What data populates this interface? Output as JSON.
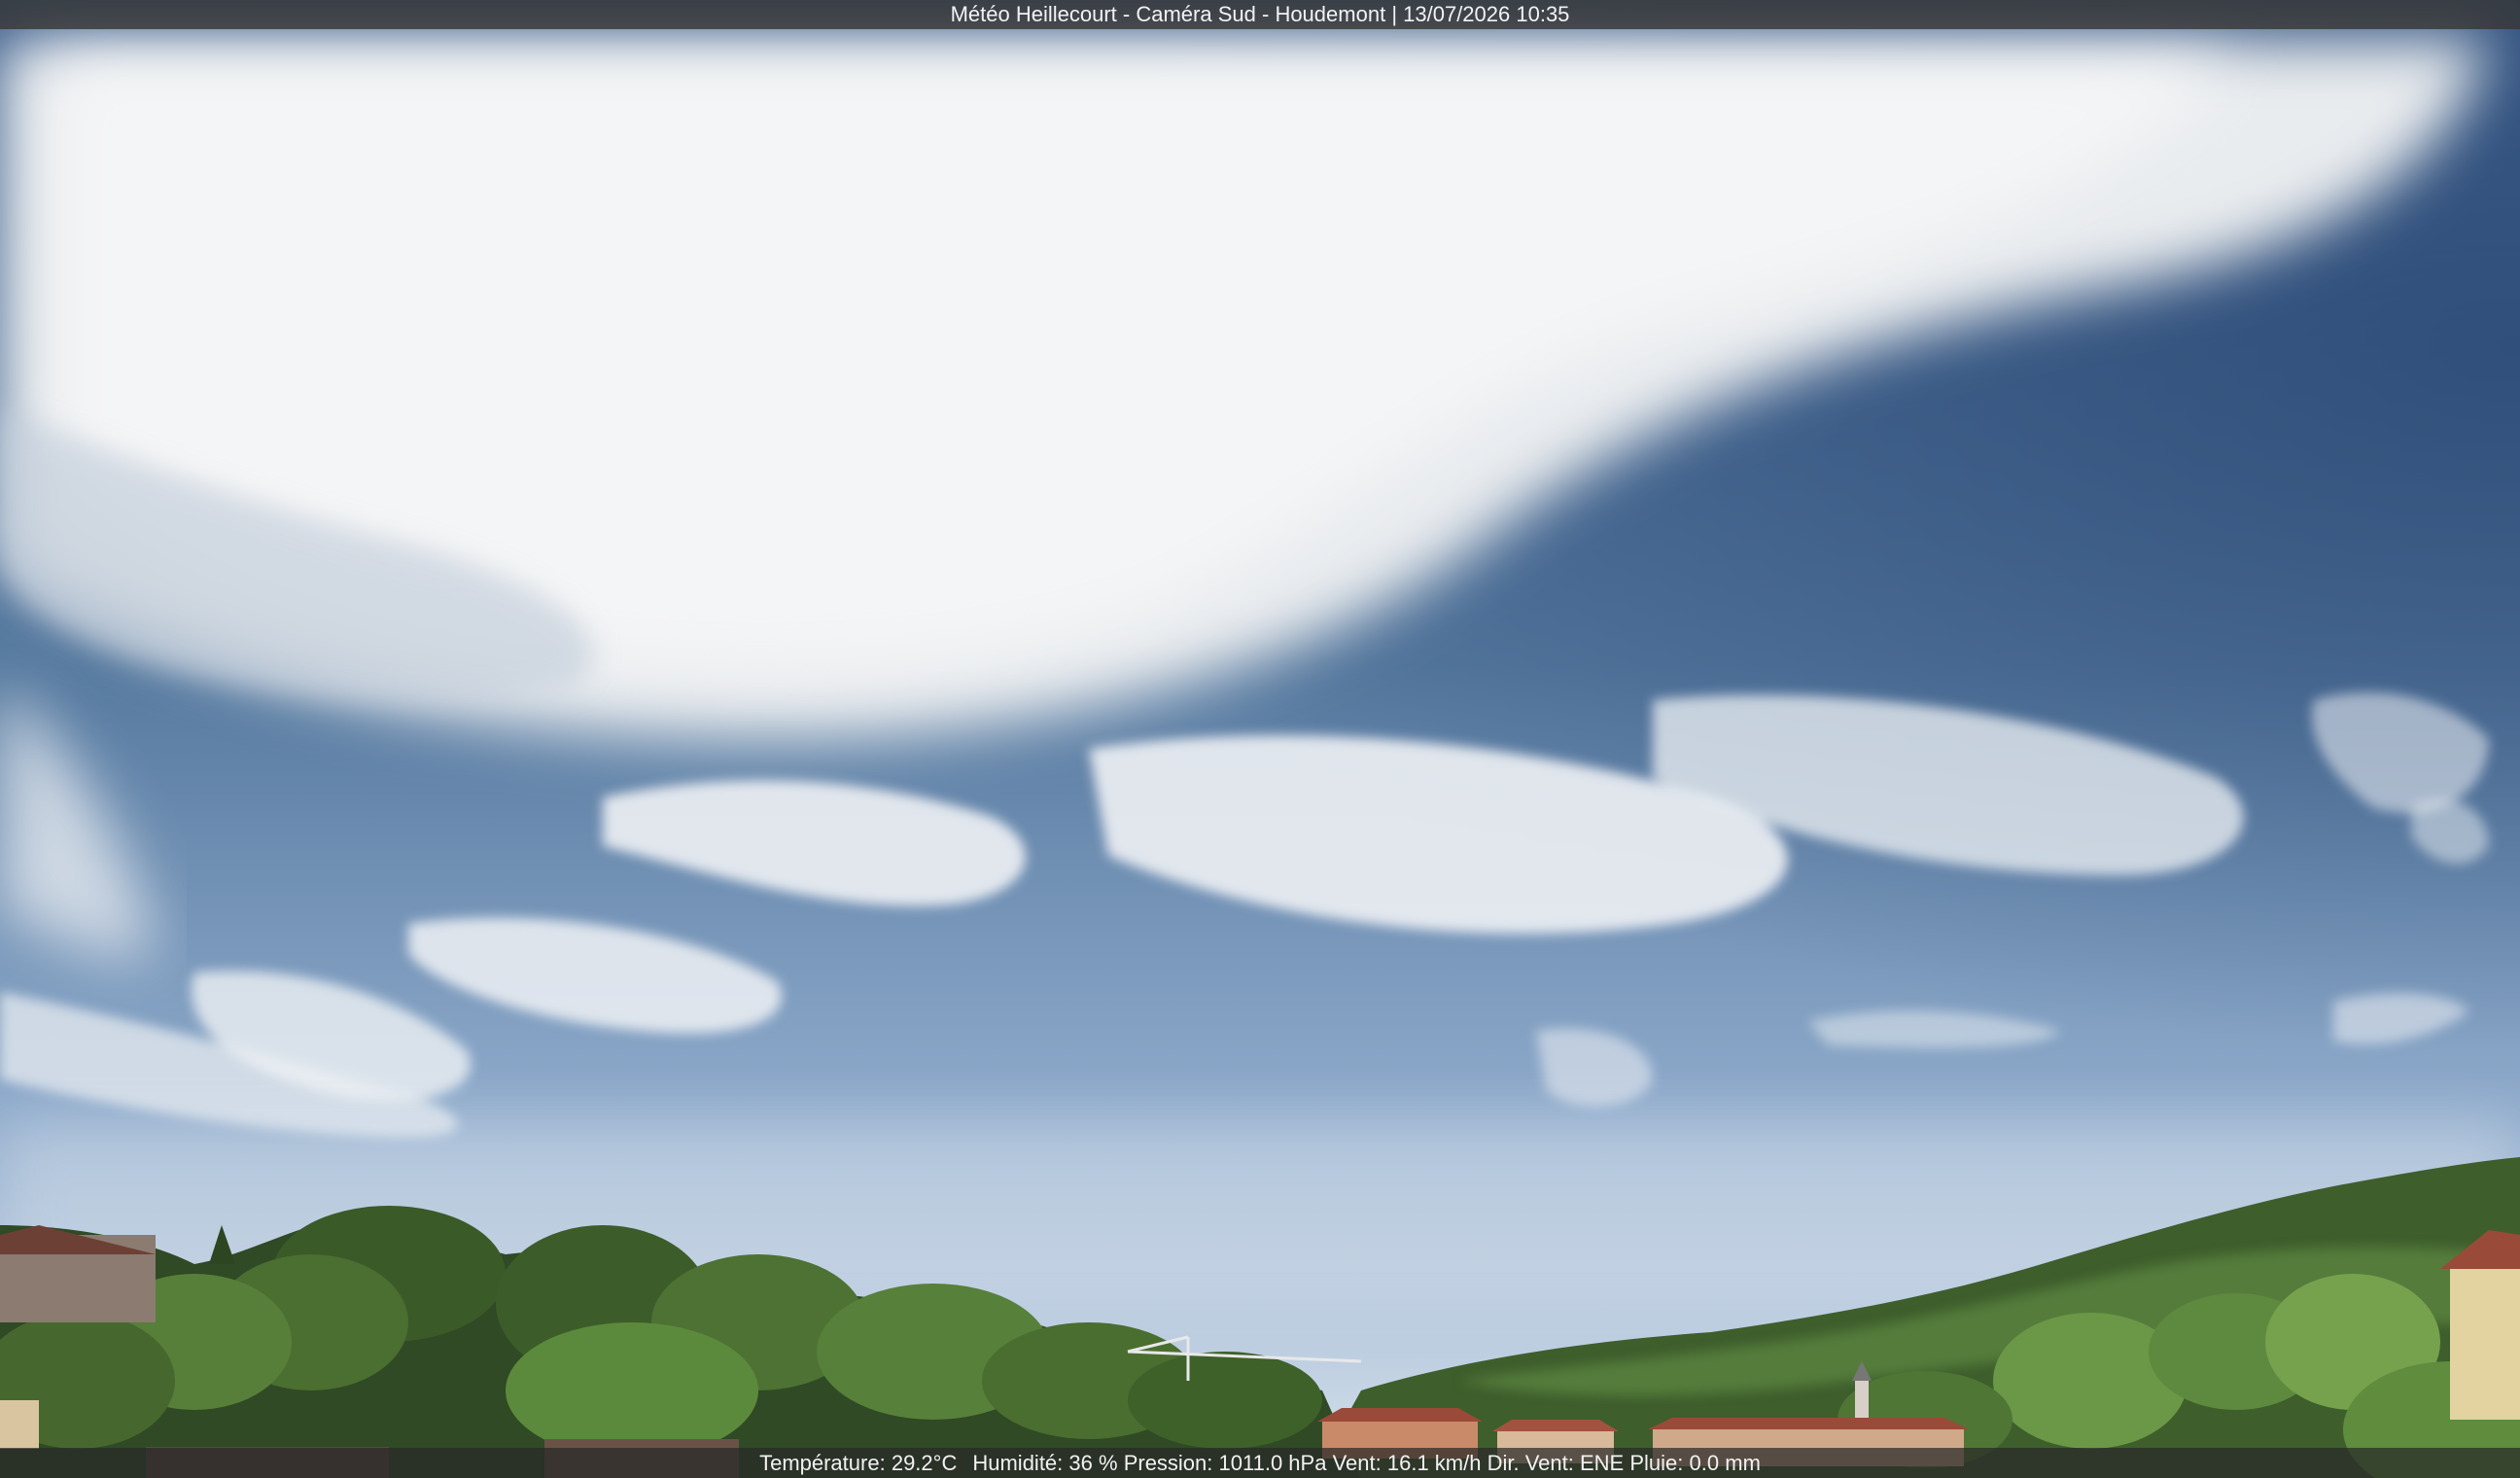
{
  "header": {
    "station": "Météo Heillecourt",
    "camera": "Caméra Sud",
    "location": "Houdemont",
    "datetime": "13/07/2026 10:35"
  },
  "weather": {
    "temperature_label": "Température:",
    "temperature_value": "29.2°C",
    "humidity_label": "Humidité:",
    "humidity_value": "36 %",
    "pressure_label": "Pression:",
    "pressure_value": "1011.0 hPa",
    "wind_label": "Vent:",
    "wind_value": "16.1 km/h",
    "wind_dir_label": "Dir. Vent:",
    "wind_dir_value": "ENE",
    "rain_label": "Pluie:",
    "rain_value": "0.0 mm"
  },
  "colors": {
    "sky_top": "#3f6390",
    "sky_horizon": "#c9d8e8",
    "cloud": "#eef1f4",
    "foliage_dark": "#2c4a22",
    "foliage_light": "#6f9447",
    "roof": "#9a4a38"
  }
}
